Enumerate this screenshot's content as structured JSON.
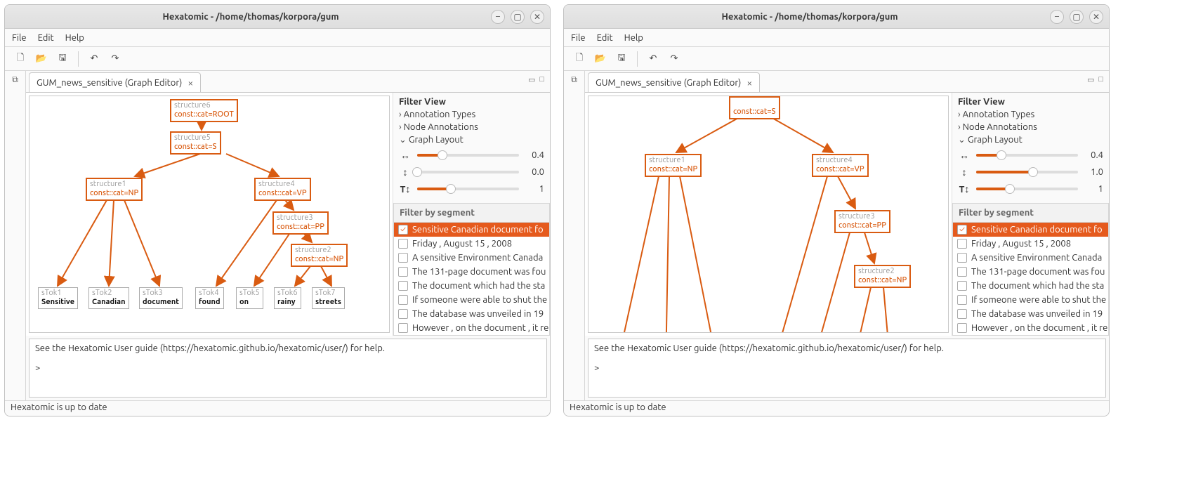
{
  "window": {
    "title": "Hexatomic - /home/thomas/korpora/gum"
  },
  "menu": {
    "file": "File",
    "edit": "Edit",
    "help": "Help"
  },
  "tab": {
    "label": "GUM_news_sensitive (Graph Editor)"
  },
  "side": {
    "filter_view": "Filter View",
    "ann_types": "Annotation Types",
    "node_ann": "Node Annotations",
    "graph_layout": "Graph Layout",
    "filter_by_segment": "Filter by segment"
  },
  "layout_left": {
    "horiz": "0.4",
    "vert": "0.0",
    "text": "1"
  },
  "layout_right": {
    "horiz": "0.4",
    "vert": "1.0",
    "text": "1"
  },
  "segments": [
    "Sensitive Canadian document fo",
    "Friday , August 15 , 2008",
    "A sensitive Environment Canada",
    "The 131-page document was fou",
    "The document which had the sta",
    "If someone were able to shut the",
    "The database was unveiled in 19",
    "However , on the document , it re"
  ],
  "graph": {
    "nodes": {
      "s6": {
        "id": "structure6",
        "ann": "const::cat=ROOT"
      },
      "s5": {
        "id": "structure5",
        "ann": "const::cat=S"
      },
      "s1": {
        "id": "structure1",
        "ann": "const::cat=NP"
      },
      "s4": {
        "id": "structure4",
        "ann": "const::cat=VP"
      },
      "s3": {
        "id": "structure3",
        "ann": "const::cat=PP"
      },
      "s2": {
        "id": "structure2",
        "ann": "const::cat=NP"
      }
    },
    "tokens": {
      "t1": {
        "id": "sTok1",
        "txt": "Sensitive"
      },
      "t2": {
        "id": "sTok2",
        "txt": "Canadian"
      },
      "t3": {
        "id": "sTok3",
        "txt": "document"
      },
      "t4": {
        "id": "sTok4",
        "txt": "found"
      },
      "t5": {
        "id": "sTok5",
        "txt": "on"
      },
      "t6": {
        "id": "sTok6",
        "txt": "rainy"
      },
      "t7": {
        "id": "sTok7",
        "txt": "streets"
      }
    }
  },
  "console": {
    "line1": "See the Hexatomic User guide (https://hexatomic.github.io/hexatomic/user/) for help.",
    "prompt": ">"
  },
  "status": "Hexatomic is up to date"
}
